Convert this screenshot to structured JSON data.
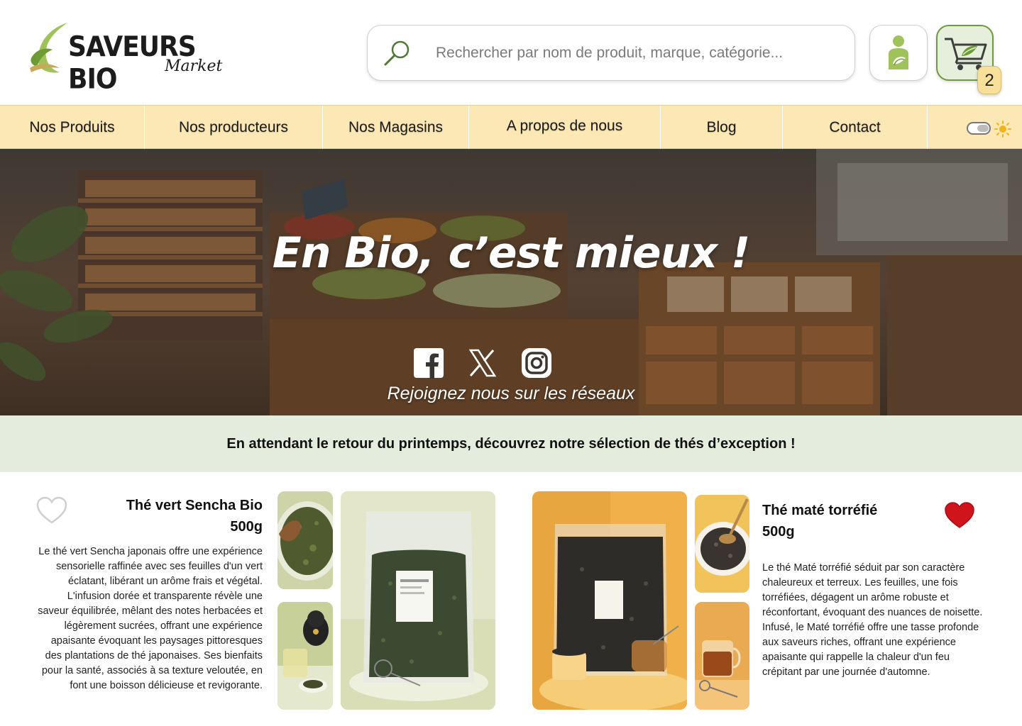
{
  "brand": {
    "name": "SAVEURS BIO",
    "tagline": "Market"
  },
  "search": {
    "placeholder": "Rechercher par nom de produit, marque, catégorie..."
  },
  "cart": {
    "count": "2"
  },
  "nav": {
    "items": [
      "Nos Produits",
      "Nos producteurs",
      "Nos Magasins",
      "A propos de nous",
      "Blog",
      "Contact"
    ]
  },
  "hero": {
    "title": "En Bio, c’est mieux !",
    "subtitle": "Rejoignez nous sur les réseaux"
  },
  "banner": {
    "text": "En attendant le retour du printemps, découvrez notre sélection de thés d’exception !"
  },
  "products": [
    {
      "title_line1": "Thé vert Sencha Bio",
      "title_line2": "500g",
      "favorite": false,
      "description": "Le thé vert Sencha japonais offre une expérience sensorielle raffinée avec ses feuilles d'un vert éclatant, libérant un arôme frais et végétal. L'infusion dorée et transparente révèle une saveur équilibrée, mêlant des notes herbacées et légèrement sucrées, offrant une expérience apaisante évoquant les paysages pittoresques des plantations de thé japonaises. Ses bienfaits pour la santé, associés à sa texture veloutée, en font une boisson délicieuse et revigorante."
    },
    {
      "title_line1": "Thé maté torréfié",
      "title_line2": "500g",
      "favorite": true,
      "description": "Le thé Maté torréfié séduit par son caractère chaleureux et terreux. Les feuilles, une fois torréfiées, dégagent un arôme robuste et réconfortant, évoquant des nuances de noisette. Infusé, le Maté torréfié offre une tasse profonde aux saveurs riches, offrant une expérience apaisante qui rappelle la chaleur d'un feu crépitant par une journée d'automne."
    }
  ],
  "colors": {
    "nav_bg": "#fbe8b4",
    "banner_bg": "#e3ecdd",
    "accent_green": "#6c9a3c",
    "heart_red": "#d0141b"
  }
}
